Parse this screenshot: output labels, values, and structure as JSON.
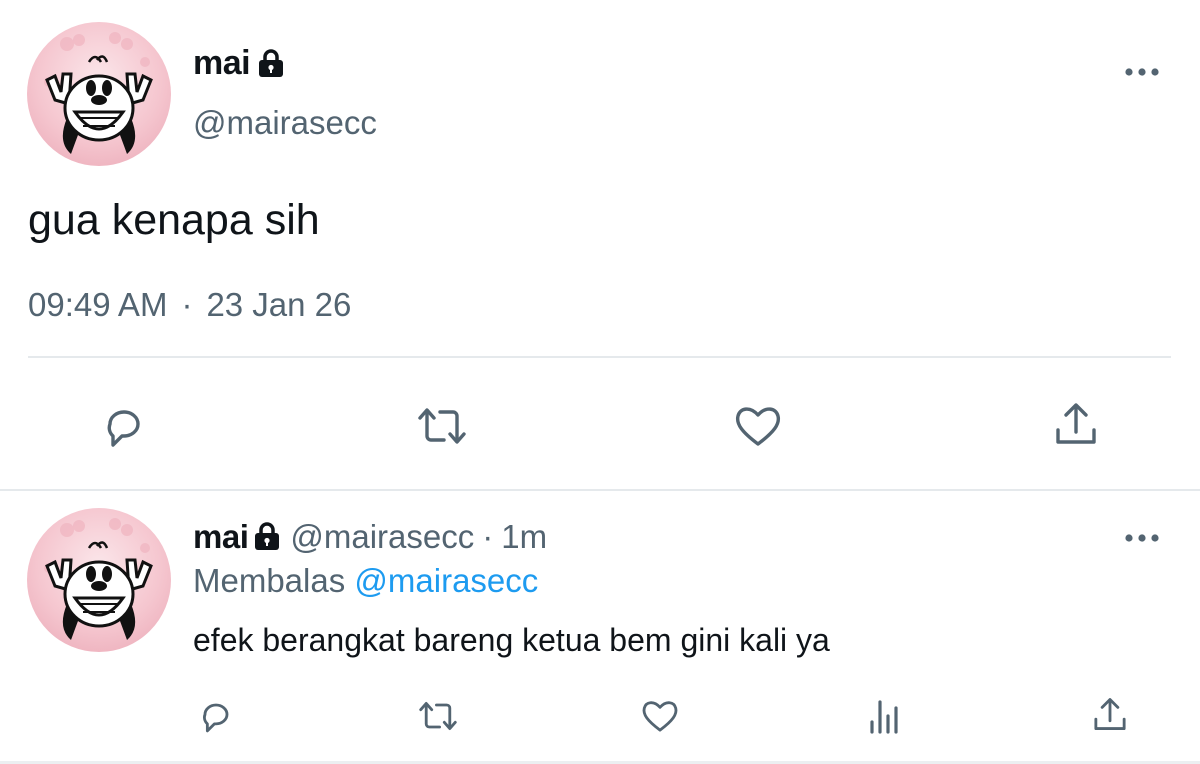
{
  "main_tweet": {
    "display_name": "mai",
    "protected_icon": "lock-icon",
    "handle": "@mairasecc",
    "more_icon": "more-horizontal-icon",
    "text": "gua kenapa sih",
    "time": "09:49 AM",
    "separator": "·",
    "date": "23 Jan 26",
    "actions": [
      "reply-icon",
      "retweet-icon",
      "like-icon",
      "share-icon"
    ]
  },
  "reply_tweet": {
    "display_name": "mai",
    "protected_icon": "lock-icon",
    "handle": "@mairasecc",
    "separator": "·",
    "age": "1m",
    "replying_prefix": "Membalas",
    "replying_to": "@mairasecc",
    "more_icon": "more-horizontal-icon",
    "text": "efek berangkat bareng ketua bem gini kali ya",
    "actions": [
      "reply-icon",
      "retweet-icon",
      "like-icon",
      "views-icon",
      "share-icon"
    ]
  },
  "colors": {
    "text_primary": "#0f1419",
    "text_secondary": "#536471",
    "link": "#1d9bf0",
    "divider": "#e5e9ec",
    "avatar_pink": "#f5c6cf"
  }
}
